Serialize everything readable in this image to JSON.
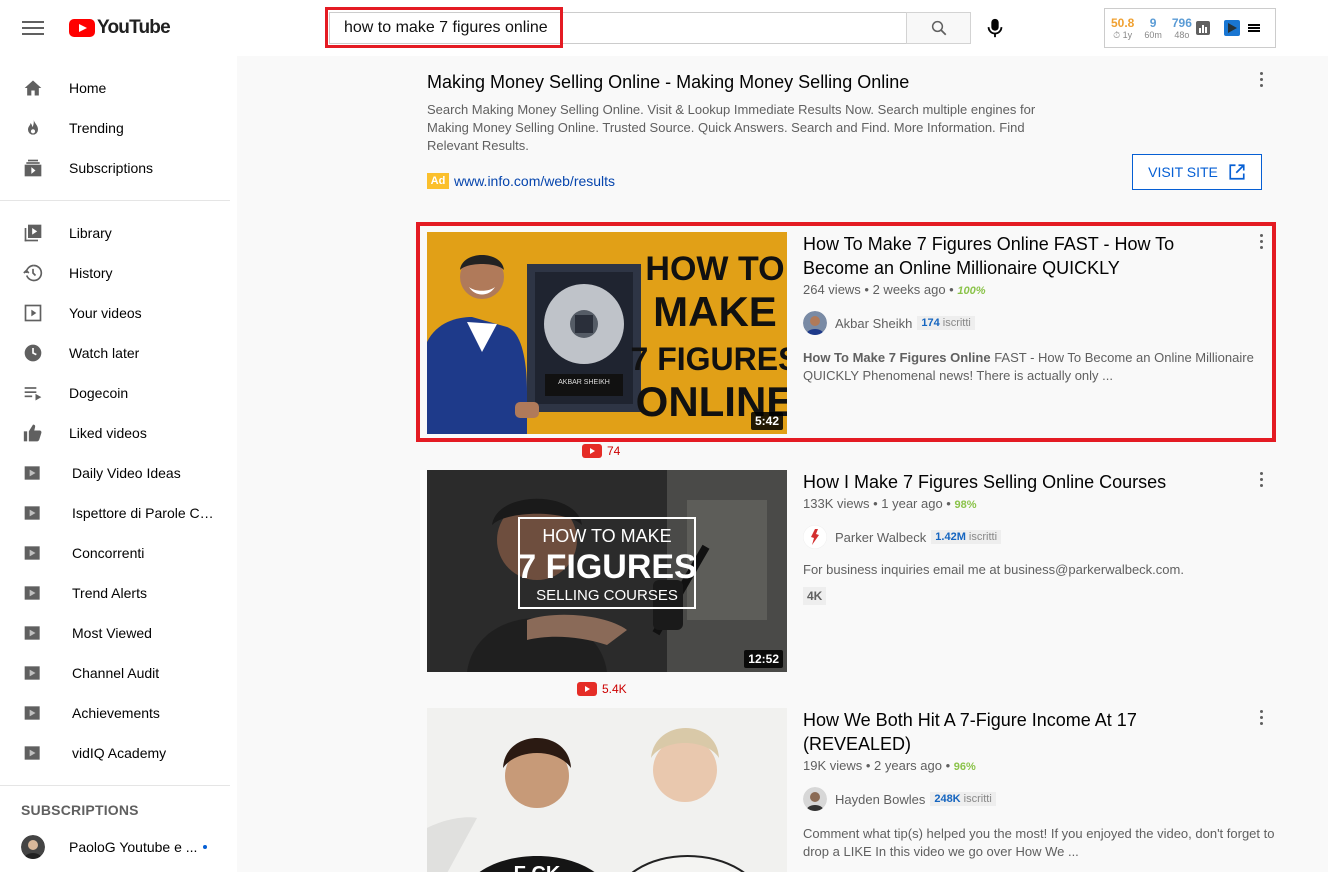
{
  "header": {
    "logo_text": "YouTube",
    "search_value": "how to make 7 figures online",
    "vidiq": {
      "stats": [
        {
          "value": "50.8",
          "sub": "⏱ 1y",
          "color": "#f0a030"
        },
        {
          "value": "9",
          "sub": "60m",
          "color": "#5a9bd5"
        },
        {
          "value": "796",
          "sub": "48o",
          "color": "#5a9bd5"
        }
      ]
    }
  },
  "sidebar": {
    "main": [
      {
        "label": "Home",
        "icon": "home-icon"
      },
      {
        "label": "Trending",
        "icon": "flame-icon"
      },
      {
        "label": "Subscriptions",
        "icon": "subscriptions-icon"
      }
    ],
    "library": [
      {
        "label": "Library",
        "icon": "library-icon"
      },
      {
        "label": "History",
        "icon": "history-icon"
      },
      {
        "label": "Your videos",
        "icon": "play-square-icon"
      },
      {
        "label": "Watch later",
        "icon": "clock-icon"
      },
      {
        "label": "Dogecoin",
        "icon": "playlist-icon"
      },
      {
        "label": "Liked videos",
        "icon": "thumbs-up-icon"
      }
    ],
    "playlists": [
      {
        "label": "Daily Video Ideas"
      },
      {
        "label": "Ispettore di Parole Chiave"
      },
      {
        "label": "Concorrenti"
      },
      {
        "label": "Trend Alerts"
      },
      {
        "label": "Most Viewed"
      },
      {
        "label": "Channel Audit"
      },
      {
        "label": "Achievements"
      },
      {
        "label": "vidIQ Academy"
      }
    ],
    "subscriptions_heading": "SUBSCRIPTIONS",
    "subscriptions": [
      {
        "label": "PaoloG Youtube e ..."
      }
    ]
  },
  "ad": {
    "title": "Making Money Selling Online - Making Money Selling Online",
    "description": "Search Making Money Selling Online. Visit & Lookup Immediate Results Now. Search multiple engines for Making Money Selling Online. Trusted Source. Quick Answers. Search and Find. More Information. Find Relevant Results.",
    "badge": "Ad",
    "url": "www.info.com/web/results",
    "visit_label": "VISIT SITE"
  },
  "results": [
    {
      "title": "How To Make 7 Figures Online FAST - How To Become an Online Millionaire QUICKLY",
      "meta": "264 views • 2 weeks ago • ",
      "score": "100%",
      "channel": "Akbar Sheikh",
      "subs_num": "174",
      "subs_label": " iscritti",
      "desc_bold": "How To Make 7 Figures Online",
      "desc": " FAST - How To Become an Online Millionaire QUICKLY Phenomenal news! There is actually only ...",
      "duration": "5:42",
      "yt_count": "74",
      "thumb_text": [
        "HOW TO",
        "MAKE",
        "7 FIGURES",
        "ONLINE"
      ],
      "plaque_name": "AKBAR SHEIKH"
    },
    {
      "title": "How I Make 7 Figures Selling Online Courses",
      "meta": "133K views • 1 year ago • ",
      "score": "98%",
      "channel": "Parker Walbeck",
      "subs_num": "1.42M",
      "subs_label": " iscritti",
      "desc": "For business inquiries email me at business@parkerwalbeck.com.",
      "badge": "4K",
      "duration": "12:52",
      "yt_count": "5.4K",
      "thumb_text": [
        "HOW TO MAKE",
        "7 FIGURES",
        "SELLING COURSES"
      ]
    },
    {
      "title": "How We Both Hit A 7-Figure Income At 17 (REVEALED)",
      "meta": "19K views • 2 years ago • ",
      "score": "96%",
      "channel": "Hayden Bowles",
      "subs_num": "248K",
      "subs_label": " iscritti",
      "desc": "Comment what tip(s) helped you the most! If you enjoyed the video, don't forget to drop a LIKE In this video we go over How We ...",
      "shirt_text": "F CK"
    }
  ]
}
